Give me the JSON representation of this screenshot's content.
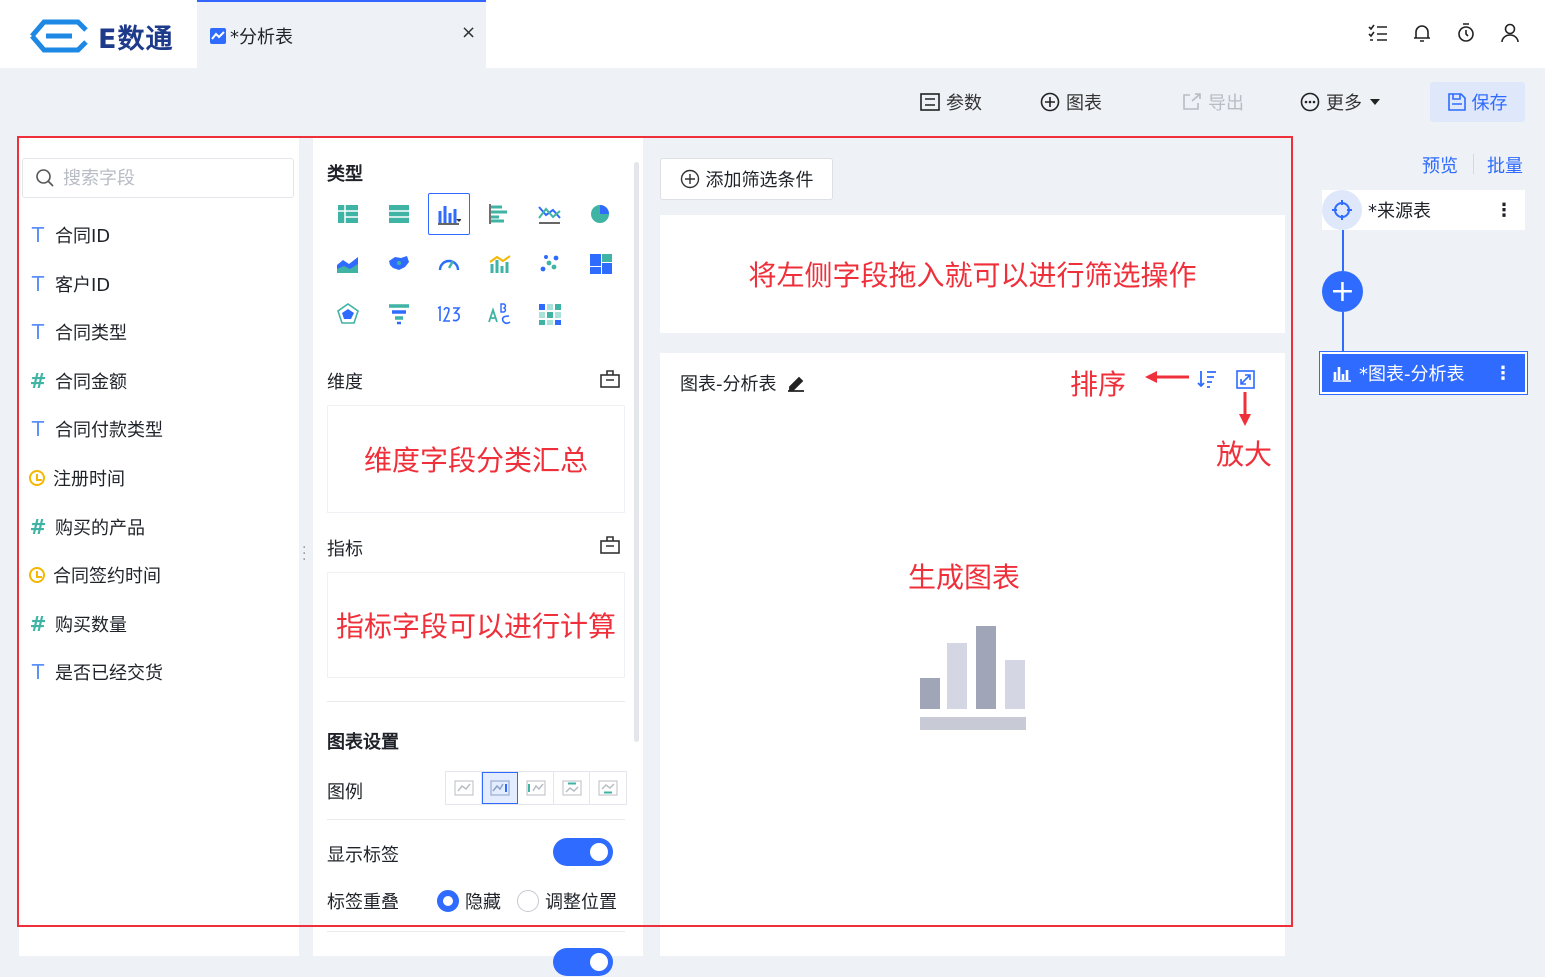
{
  "app": {
    "name": "E数通",
    "tab_title": "*分析表",
    "tab_close": "×"
  },
  "toolbar": {
    "params": "参数",
    "chart": "图表",
    "export": "导出",
    "more": "更多",
    "save": "保存"
  },
  "search": {
    "placeholder": "搜索字段"
  },
  "fields": [
    {
      "type": "T",
      "label": "合同ID"
    },
    {
      "type": "T",
      "label": "客户ID"
    },
    {
      "type": "T",
      "label": "合同类型"
    },
    {
      "type": "N",
      "label": "合同金额"
    },
    {
      "type": "T",
      "label": "合同付款类型"
    },
    {
      "type": "D",
      "label": "注册时间"
    },
    {
      "type": "N",
      "label": "购买的产品"
    },
    {
      "type": "D",
      "label": "合同签约时间"
    },
    {
      "type": "N",
      "label": "购买数量"
    },
    {
      "type": "T",
      "label": "是否已经交货"
    }
  ],
  "config": {
    "type_title": "类型",
    "dimension_label": "维度",
    "dimension_hint": "维度字段分类汇总",
    "metric_label": "指标",
    "metric_hint": "指标字段可以进行计算",
    "settings_title": "图表设置",
    "legend_label": "图例",
    "show_label": "显示标签",
    "overlap_label": "标签重叠",
    "overlap_hide": "隐藏",
    "overlap_adjust": "调整位置"
  },
  "filter": {
    "add_button": "添加筛选条件",
    "hint": "将左侧字段拖入就可以进行筛选操作"
  },
  "chart": {
    "title": "图表-分析表",
    "sort_annotation": "排序",
    "zoom_annotation": "放大",
    "generate_annotation": "生成图表"
  },
  "flow": {
    "preview": "预览",
    "batch": "批量",
    "source_node": "*来源表",
    "chart_node": "*图表-分析表",
    "menu": "⋮",
    "plus": "+"
  },
  "colors": {
    "accent": "#2f6bff",
    "annotation": "#ef2f3a"
  }
}
